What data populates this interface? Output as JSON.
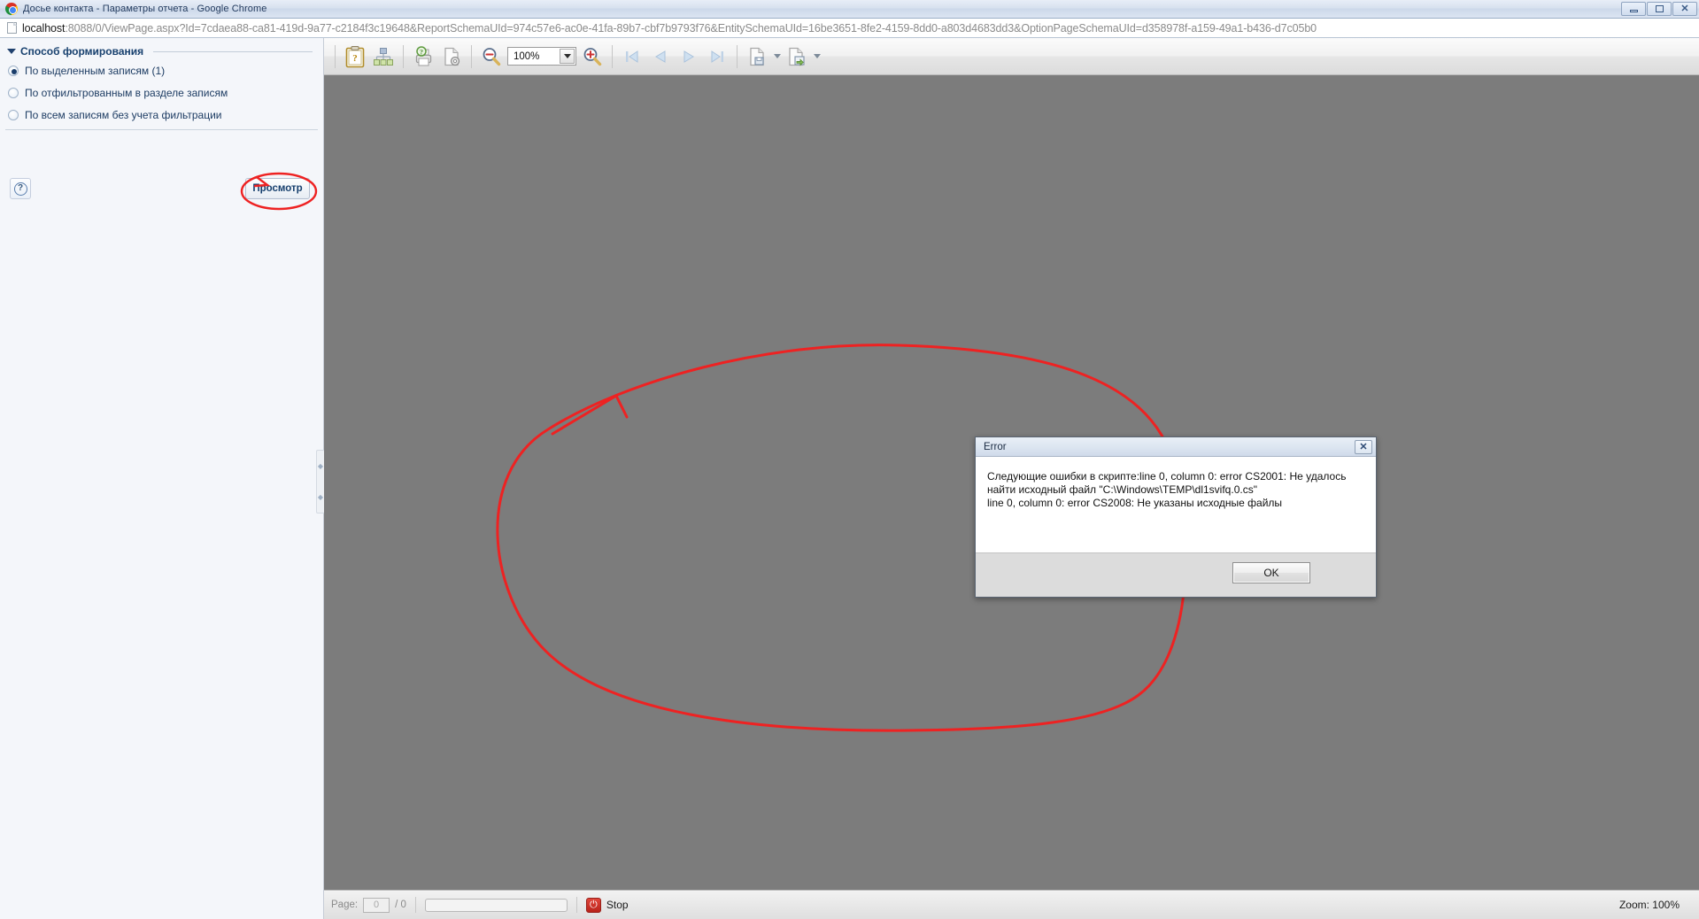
{
  "window": {
    "title": "Досье контакта - Параметры отчета - Google Chrome",
    "logo_icon": "chrome-logo-icon",
    "minimize_label": "–",
    "maximize_label": "□",
    "close_label": "✕"
  },
  "address_bar": {
    "page_icon": "page-document-icon",
    "host": "localhost",
    "path": ":8088/0/ViewPage.aspx?Id=7cdaea88-ca81-419d-9a77-c2184f3c19648&ReportSchemaUId=974c57e6-ac0e-41fa-89b7-cbf7b9793f76&EntitySchemaUId=16be3651-8fe2-4159-8dd0-a803d4683dd3&OptionPageSchemaUId=d358978f-a159-49a1-b436-d7c05b0"
  },
  "sidebar": {
    "group_title": "Способ формирования",
    "collapse_icon": "triangle-down-icon",
    "options": [
      {
        "label": "По выделенным записям (1)",
        "checked": true
      },
      {
        "label": "По отфильтрованным в разделе записям",
        "checked": false
      },
      {
        "label": "По всем записям без учета фильтрации",
        "checked": false
      }
    ],
    "help_icon": "question-mark-icon",
    "preview_button": "Просмотр"
  },
  "splitter": {
    "icon": "splitter-handle-icon",
    "glyph_up": "◆",
    "glyph_down": "◆"
  },
  "toolbar": {
    "buttons": [
      {
        "name": "report-parameters-icon",
        "title": "Параметры отчета"
      },
      {
        "name": "document-map-icon",
        "title": "Карта документа"
      },
      {
        "name": "print-icon",
        "title": "Печать"
      },
      {
        "name": "page-setup-icon",
        "title": "Параметры страницы"
      },
      {
        "name": "zoom-out-icon",
        "title": "Уменьшить"
      },
      {
        "name": "zoom-in-icon",
        "title": "Увеличить"
      },
      {
        "name": "first-page-icon",
        "title": "Первая страница"
      },
      {
        "name": "previous-page-icon",
        "title": "Предыдущая страница"
      },
      {
        "name": "next-page-icon",
        "title": "Следующая страница"
      },
      {
        "name": "last-page-icon",
        "title": "Последняя страница"
      },
      {
        "name": "save-icon",
        "title": "Сохранить"
      },
      {
        "name": "export-icon",
        "title": "Экспорт"
      }
    ],
    "zoom_value": "100%",
    "zoom_dropdown_icon": "chevron-down-icon"
  },
  "dialog": {
    "title": "Error",
    "close_label": "✕",
    "close_icon": "close-icon",
    "message": "Следующие ошибки в скрипте:line 0, column 0: error CS2001: Не удалось найти исходный файл \"C:\\Windows\\TEMP\\dl1svifq.0.cs\"\nline 0, column 0: error CS2008: Не указаны исходные файлы",
    "ok_label": "OK"
  },
  "statusbar": {
    "page_label": "Page:",
    "page_value": "0",
    "page_total": "/ 0",
    "progress_value": 0,
    "stop_label": "Stop",
    "stop_icon": "stop-power-icon",
    "zoom_label": "Zoom: 100%"
  },
  "annotations": {
    "accent_color": "#ee2222",
    "preview_circle": "red-ellipse-around-preview-button",
    "canvas_circle": "red-ellipse-around-error-dialog"
  }
}
